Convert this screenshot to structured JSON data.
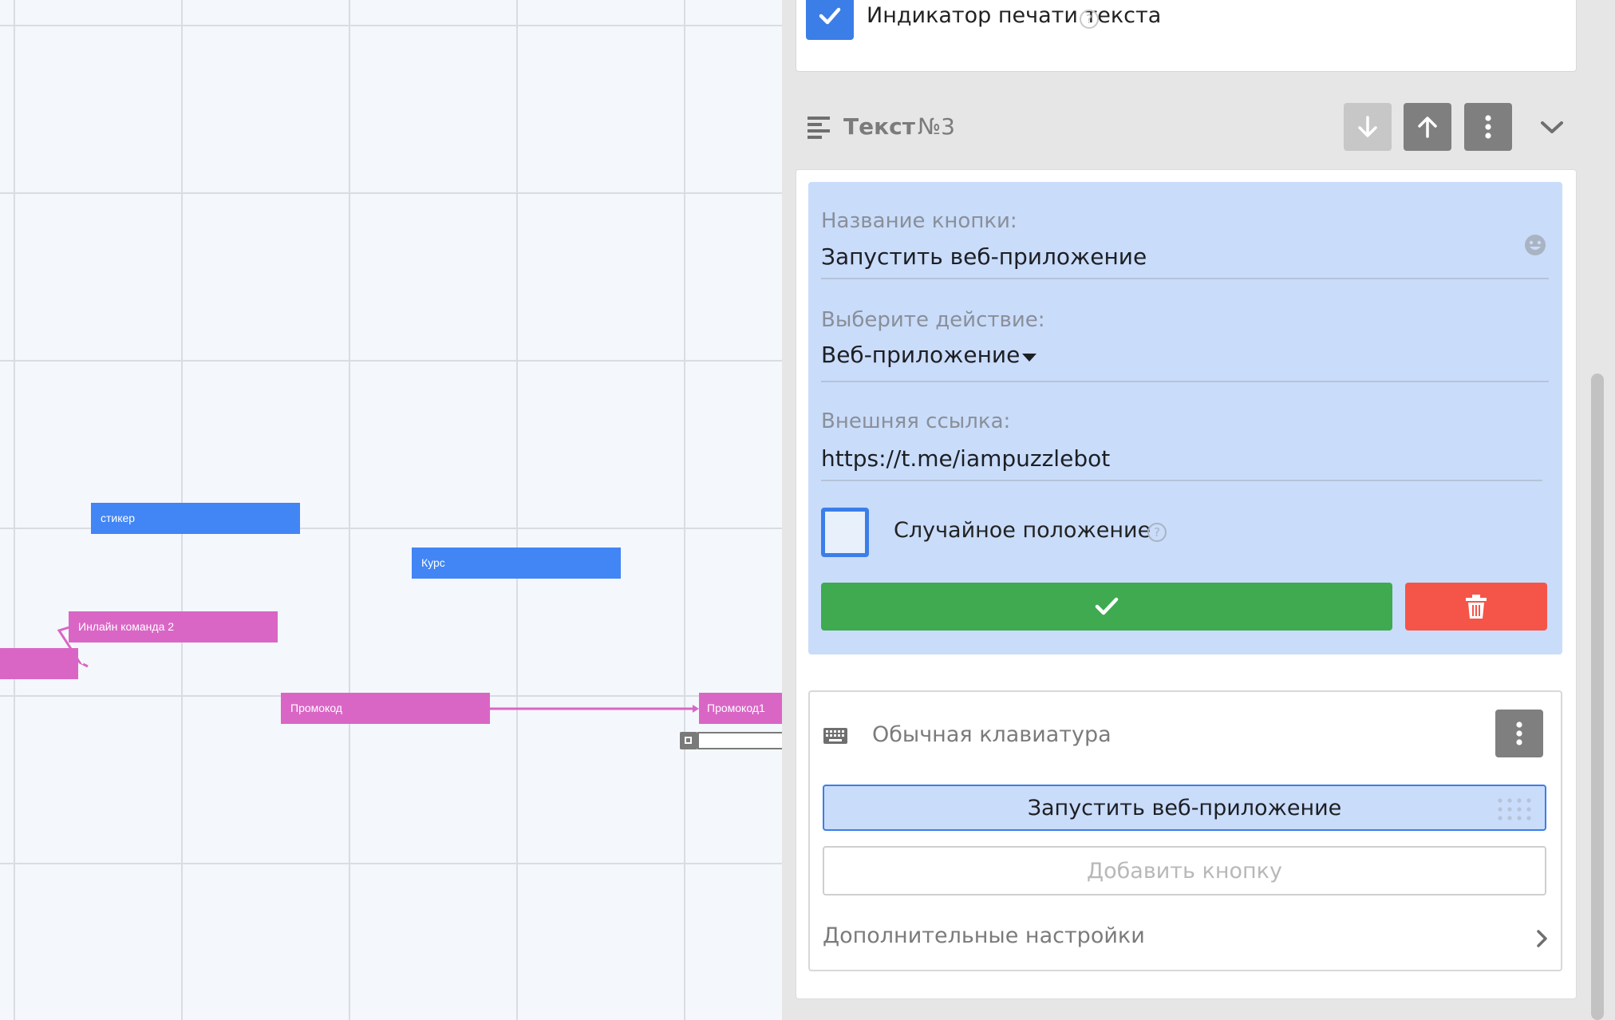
{
  "canvas": {
    "nodes": [
      {
        "label": "стикер",
        "color": "blue"
      },
      {
        "label": "Курс",
        "color": "blue"
      },
      {
        "label": "Инлайн команда 2",
        "color": "pink"
      },
      {
        "label": "Промокод",
        "color": "pink"
      },
      {
        "label": "Промокод1",
        "color": "pink"
      }
    ],
    "colors": {
      "blue_node": "#4285f4",
      "pink_node": "#d966c5",
      "grid": "#d9dde3"
    }
  },
  "panel": {
    "typing_indicator": {
      "label": "Индикатор печати текста",
      "checked": true,
      "help_glyph": "?"
    },
    "section": {
      "title": "Текст",
      "number": "№3",
      "icon": "text-align-left-icon",
      "buttons": [
        "arrow-down-icon",
        "arrow-up-icon",
        "more-vertical-icon",
        "chevron-down-icon"
      ]
    },
    "form": {
      "button_name_label": "Название кнопки:",
      "button_name_value": "Запустить веб-приложение",
      "action_label": "Выберите действие:",
      "action_value": "Веб-приложение",
      "link_label": "Внешняя ссылка:",
      "link_value": "https://t.me/iampuzzlebot",
      "random_position_label": "Случайное положение",
      "random_position_checked": false,
      "help_glyph": "?",
      "emoji_icon": "smiley-icon",
      "confirm_icon": "check-icon",
      "delete_icon": "trash-icon"
    },
    "keyboard": {
      "title": "Обычная клавиатура",
      "icon": "keyboard-icon",
      "buttons": [
        {
          "label": "Запустить веб-приложение",
          "active": true
        }
      ],
      "add_button_label": "Добавить кнопку",
      "advanced_settings_label": "Дополнительные настройки"
    },
    "colors": {
      "accent_blue": "#3b7ee8",
      "form_bg": "#c9dcfa",
      "confirm_green": "#3faa50",
      "delete_red": "#f55548",
      "gray_button": "#7f7f7f"
    }
  }
}
